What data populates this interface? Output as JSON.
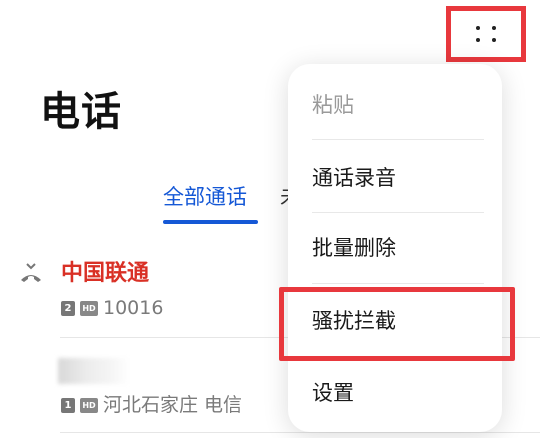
{
  "header": {
    "title": "电话"
  },
  "tabs": {
    "all_calls": "全部通话",
    "partial_next": "未"
  },
  "calls": [
    {
      "name": "中国联通",
      "sim": "2",
      "hd": "HD",
      "detail": "10016"
    },
    {
      "name": "",
      "sim": "1",
      "hd": "HD",
      "detail": "河北石家庄 电信"
    }
  ],
  "menu": {
    "items": [
      {
        "label": "粘贴",
        "disabled": true
      },
      {
        "label": "通话录音"
      },
      {
        "label": "批量删除"
      },
      {
        "label": "骚扰拦截",
        "highlighted": true
      },
      {
        "label": "设置"
      }
    ]
  },
  "colors": {
    "accent_blue": "#1558d6",
    "missed_red": "#d93025",
    "highlight_red": "#e8383d"
  },
  "icons": {
    "more": "more-dots-icon",
    "missed_call": "missed-call-icon"
  }
}
